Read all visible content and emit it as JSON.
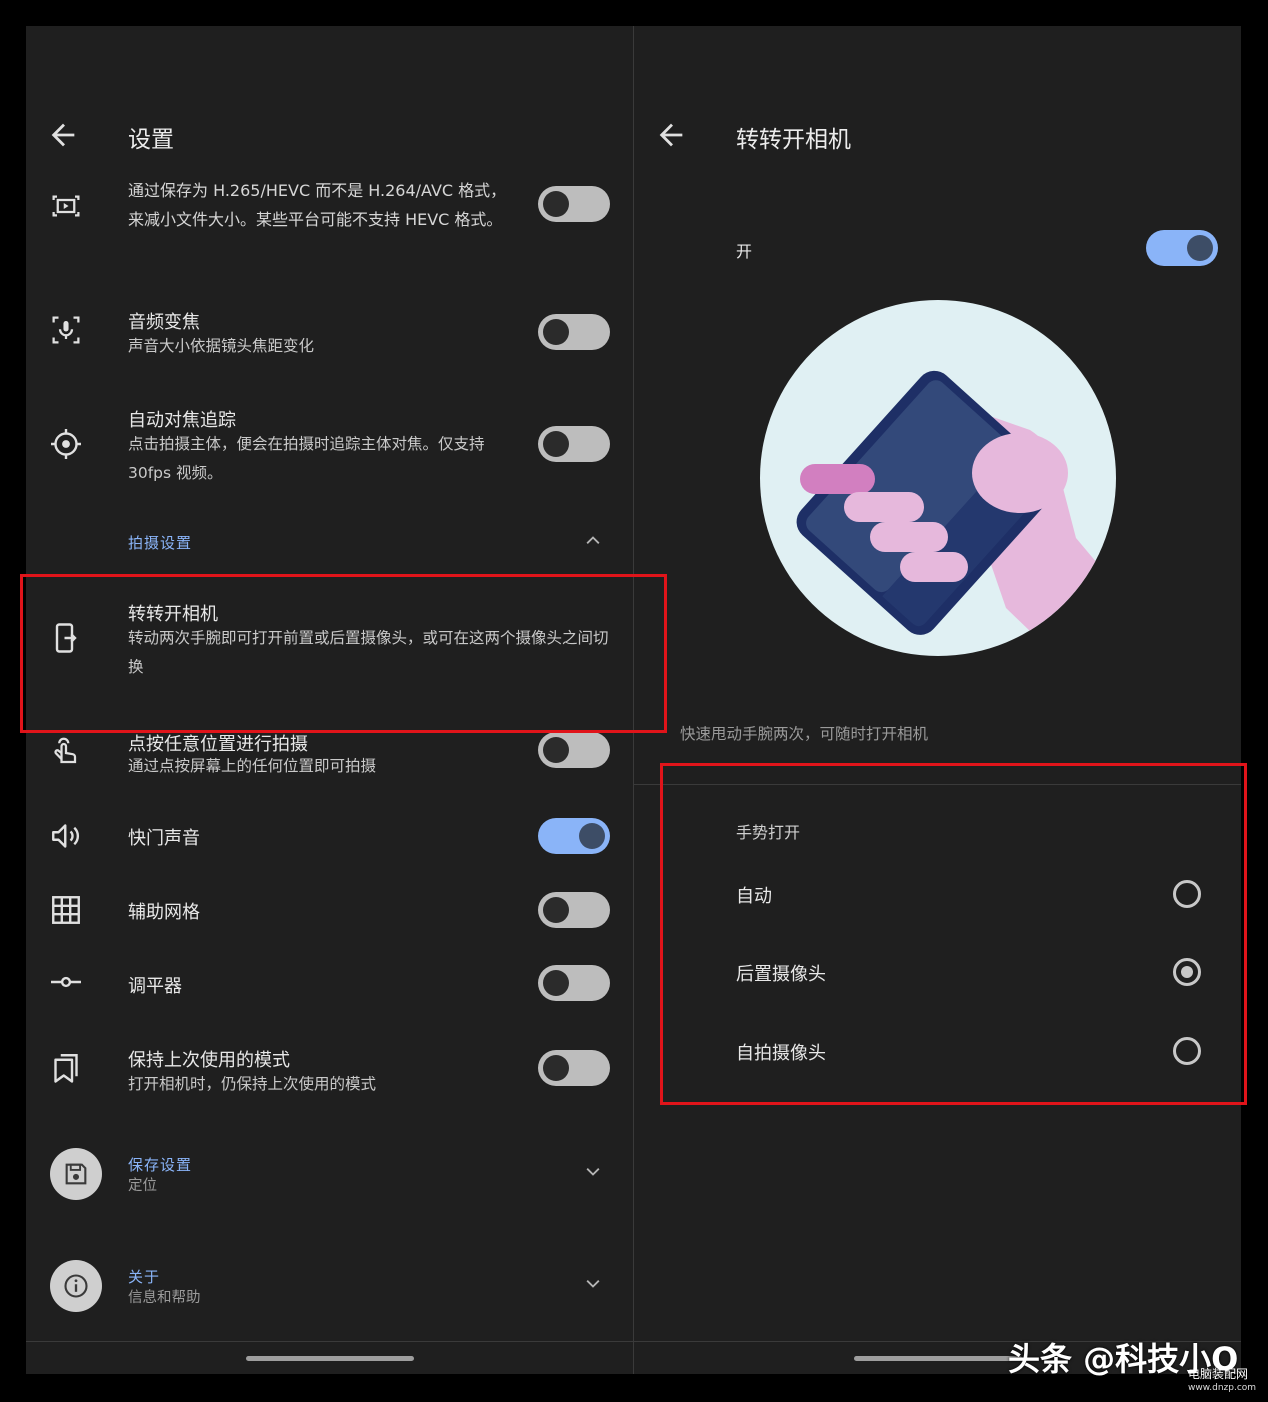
{
  "left": {
    "title": "设置",
    "items": [
      {
        "id": "hevc",
        "icon": "video-frame-icon",
        "title": "",
        "subtitle": "通过保存为 H.265/HEVC 而不是 H.264/AVC 格式，来减小文件大小。某些平台可能不支持 HEVC 格式。",
        "toggle_on": false
      },
      {
        "id": "audio-zoom",
        "icon": "mic-focus-icon",
        "title": "音频变焦",
        "subtitle": "声音大小依据镜头焦距变化",
        "toggle_on": false
      },
      {
        "id": "af-tracking",
        "icon": "crosshair-icon",
        "title": "自动对焦追踪",
        "subtitle": "点击拍摄主体，便会在拍摄时追踪主体对焦。仅支持 30fps 视频。",
        "toggle_on": false
      }
    ],
    "section_capture": "拍摄设置",
    "flip_camera": {
      "title": "转转开相机",
      "subtitle": "转动两次手腕即可打开前置或后置摄像头，或可在这两个摄像头之间切换"
    },
    "items2": [
      {
        "id": "tap-capture",
        "icon": "touch-icon",
        "title": "点按任意位置进行拍摄",
        "subtitle": "通过点按屏幕上的任何位置即可拍摄",
        "toggle_on": false
      },
      {
        "id": "shutter-sound",
        "icon": "speaker-icon",
        "title": "快门声音",
        "subtitle": "",
        "toggle_on": true
      },
      {
        "id": "grid",
        "icon": "grid-icon",
        "title": "辅助网格",
        "subtitle": "",
        "toggle_on": false
      },
      {
        "id": "level",
        "icon": "level-icon",
        "title": "调平器",
        "subtitle": "",
        "toggle_on": false
      },
      {
        "id": "keep-mode",
        "icon": "bookmark-icon",
        "title": "保持上次使用的模式",
        "subtitle": "打开相机时，仍保持上次使用的模式",
        "toggle_on": false
      }
    ],
    "save_section": {
      "title": "保存设置",
      "subtitle": "定位"
    },
    "about_section": {
      "title": "关于",
      "subtitle": "信息和帮助"
    }
  },
  "right": {
    "title": "转转开相机",
    "main_switch_label": "开",
    "main_switch_on": true,
    "description": "快速甩动手腕两次，可随时打开相机",
    "group_label": "手势打开",
    "options": [
      {
        "label": "自动",
        "checked": false
      },
      {
        "label": "后置摄像头",
        "checked": true
      },
      {
        "label": "自拍摄像头",
        "checked": false
      }
    ]
  },
  "watermark": {
    "text": "头条 @科技小O",
    "site_cn": "电脑装配网",
    "site_url": "www.dnzp.com"
  },
  "colors": {
    "accent": "#8ab4f8",
    "highlight": "#e0141a",
    "background": "#1f1f1f",
    "illustration_bg": "#e0f0f3",
    "phone": "#1e2f66",
    "hand": "#e6b8dc"
  }
}
